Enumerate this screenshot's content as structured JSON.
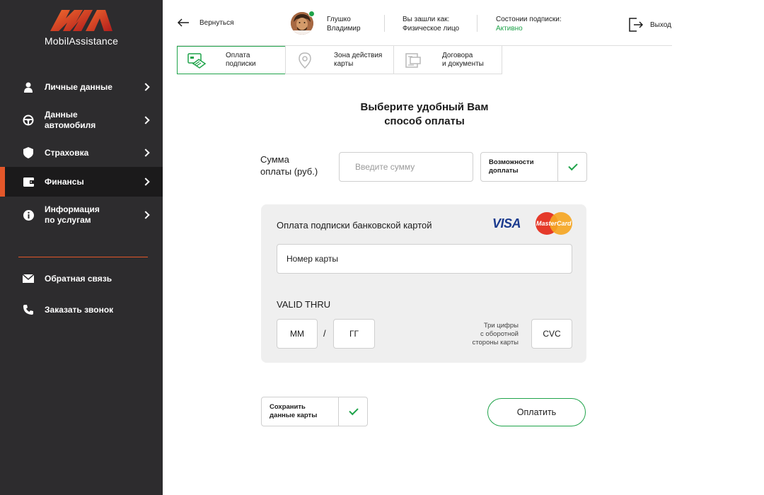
{
  "app": {
    "logo_text": "MobilAssistance"
  },
  "sidebar": {
    "items": [
      {
        "label": "Личные данные",
        "icon": "person-icon"
      },
      {
        "label": "Данные\nавтомобиля",
        "icon": "steering-wheel-icon"
      },
      {
        "label": "Страховка",
        "icon": "shield-icon"
      },
      {
        "label": "Финансы",
        "icon": "wallet-icon",
        "active": true
      },
      {
        "label": "Информация\nпо услугам",
        "icon": "info-icon"
      }
    ],
    "bottom_items": [
      {
        "label": "Обратная связь",
        "icon": "envelope-icon"
      },
      {
        "label": "Заказать звонок",
        "icon": "phone-icon"
      }
    ],
    "accent_color": "#e4572a"
  },
  "header": {
    "back_label": "Вернуться",
    "user_name": "Глушко\nВладимир",
    "login_as_label": "Вы зашли как:",
    "login_as_value": "Физическое лицо",
    "subscription_label": "Состонии подписки:",
    "subscription_value": "Активно",
    "logout_label": "Выход"
  },
  "tabs": [
    {
      "label": "Оплата\nподписки",
      "icon": "card-payment-icon",
      "active": true
    },
    {
      "label": "Зона действия\nкарты",
      "icon": "map-pin-icon"
    },
    {
      "label": "Договора\nи документы",
      "icon": "documents-icon"
    }
  ],
  "main": {
    "title": "Выберите удобный Вам\nспособ оплаты",
    "sum_label": "Сумма\nоплаты (руб.)",
    "sum_placeholder": "Введите сумму",
    "extra_payment_label": "Возможности\nдоплаты",
    "extra_payment_checked": true,
    "card_panel": {
      "title": "Оплата подписки банковской картой",
      "visa_text": "VISA",
      "mastercard_text": "MasterCard",
      "card_number_placeholder": "Номер карты",
      "valid_thru_label": "VALID THRU",
      "month_placeholder": "ММ",
      "separator": "/",
      "year_placeholder": "ГГ",
      "cvc_hint": "Три цифры\nс оборотной\nстороны карты",
      "cvc_placeholder": "CVC"
    },
    "save_card_label": "Сохранить\nданные карты",
    "save_card_checked": true,
    "pay_button_label": "Оплатить"
  },
  "colors": {
    "sidebar_bg": "#2d2c2e",
    "accent_green": "#1fa34a",
    "accent_orange": "#e4572a"
  }
}
